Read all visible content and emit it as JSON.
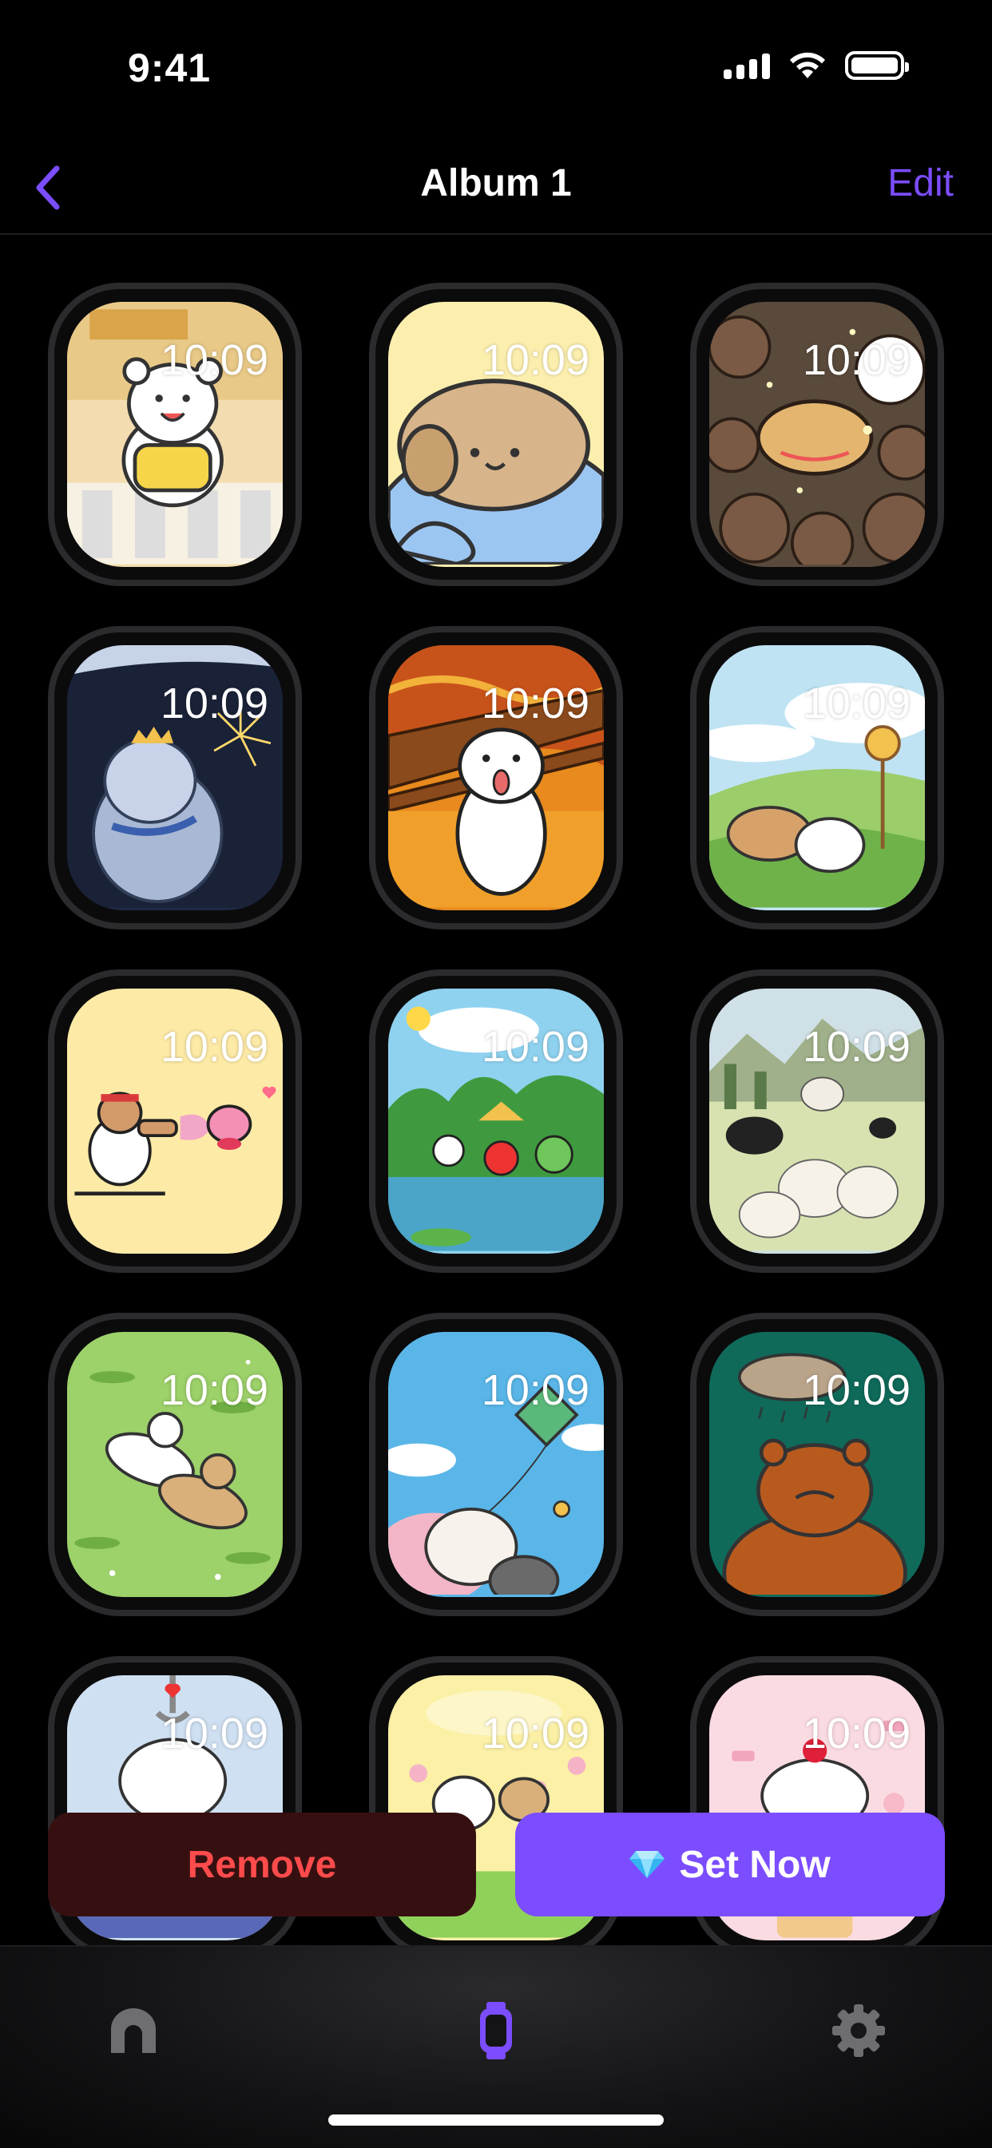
{
  "status_bar": {
    "time": "9:41"
  },
  "nav": {
    "title": "Album 1",
    "edit_label": "Edit"
  },
  "watch_time": "10:09",
  "watch_faces": [
    {
      "name": "bear-dancing-street"
    },
    {
      "name": "dog-blue-blanket"
    },
    {
      "name": "dog-puppy-pile"
    },
    {
      "name": "bear-sparkler-night"
    },
    {
      "name": "dog-scream-orange"
    },
    {
      "name": "dogs-green-hills"
    },
    {
      "name": "fighter-pink-puff"
    },
    {
      "name": "animals-pond-picnic"
    },
    {
      "name": "sheep-meadow"
    },
    {
      "name": "bears-lying-grass"
    },
    {
      "name": "cats-kite-sky"
    },
    {
      "name": "bear-rain-cloud"
    },
    {
      "name": "dog-claw-machine"
    },
    {
      "name": "dogs-yellow-garden"
    },
    {
      "name": "bear-cake-pink"
    }
  ],
  "actions": {
    "remove_label": "Remove",
    "set_now_label": "Set Now"
  },
  "colors": {
    "accent": "#7b4dff",
    "danger_text": "#ff4b4b",
    "danger_bg": "#361010"
  },
  "tabs": [
    {
      "icon": "home-icon"
    },
    {
      "icon": "watch-icon",
      "active": true
    },
    {
      "icon": "gear-icon"
    }
  ]
}
